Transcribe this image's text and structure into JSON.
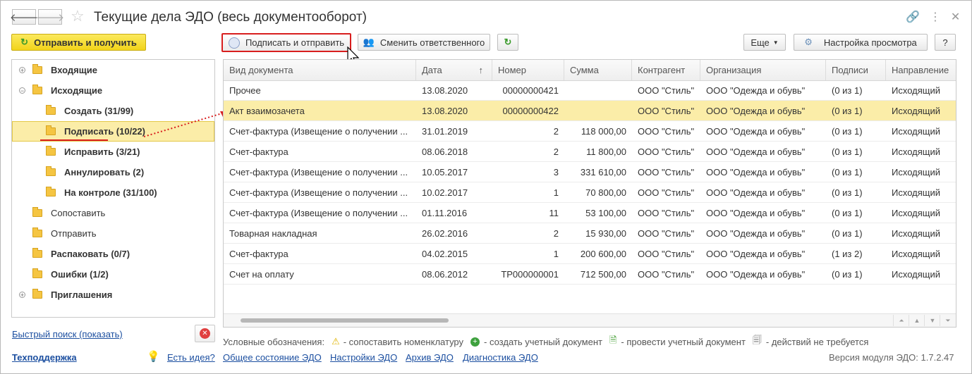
{
  "window": {
    "title": "Текущие дела ЭДО (весь документооборот)"
  },
  "toolbar": {
    "send_receive": "Отправить и получить",
    "sign_send": "Подписать и отправить",
    "change_responsible": "Сменить ответственного",
    "more": "Еще",
    "view_settings": "Настройка просмотра",
    "help": "?"
  },
  "tree": [
    {
      "label": "Входящие",
      "bold": true,
      "expander": "+"
    },
    {
      "label": "Исходящие",
      "bold": true,
      "expander": "−"
    },
    {
      "label": "Создать (31/99)",
      "bold": true
    },
    {
      "label": "Подписать (10/22)",
      "bold": true,
      "selected": true
    },
    {
      "label": "Исправить (3/21)",
      "bold": true
    },
    {
      "label": "Аннулировать (2)",
      "bold": true
    },
    {
      "label": "На контроле (31/100)",
      "bold": true
    },
    {
      "label": "Сопоставить",
      "bold": false
    },
    {
      "label": "Отправить",
      "bold": false
    },
    {
      "label": "Распаковать (0/7)",
      "bold": true
    },
    {
      "label": "Ошибки (1/2)",
      "bold": true
    },
    {
      "label": "Приглашения",
      "bold": true,
      "expander": "+"
    }
  ],
  "grid": {
    "columns": [
      "Вид документа",
      "Дата",
      "Номер",
      "Сумма",
      "Контрагент",
      "Организация",
      "Подписи",
      "Направление"
    ],
    "sort_indicator": "↑",
    "rows": [
      [
        "Прочее",
        "13.08.2020",
        "00000000421",
        "",
        "ООО \"Стиль\"",
        "ООО \"Одежда и обувь\"",
        "(0 из 1)",
        "Исходящий"
      ],
      [
        "Акт взаимозачета",
        "13.08.2020",
        "00000000422",
        "",
        "ООО \"Стиль\"",
        "ООО \"Одежда и обувь\"",
        "(0 из 1)",
        "Исходящий"
      ],
      [
        "Счет-фактура (Извещение о получении ...",
        "31.01.2019",
        "2",
        "118 000,00",
        "ООО \"Стиль\"",
        "ООО \"Одежда и обувь\"",
        "(0 из 1)",
        "Исходящий"
      ],
      [
        "Счет-фактура",
        "08.06.2018",
        "2",
        "11 800,00",
        "ООО \"Стиль\"",
        "ООО \"Одежда и обувь\"",
        "(0 из 1)",
        "Исходящий"
      ],
      [
        "Счет-фактура (Извещение о получении ...",
        "10.05.2017",
        "3",
        "331 610,00",
        "ООО \"Стиль\"",
        "ООО \"Одежда и обувь\"",
        "(0 из 1)",
        "Исходящий"
      ],
      [
        "Счет-фактура (Извещение о получении ...",
        "10.02.2017",
        "1",
        "70 800,00",
        "ООО \"Стиль\"",
        "ООО \"Одежда и обувь\"",
        "(0 из 1)",
        "Исходящий"
      ],
      [
        "Счет-фактура (Извещение о получении ...",
        "01.11.2016",
        "11",
        "53 100,00",
        "ООО \"Стиль\"",
        "ООО \"Одежда и обувь\"",
        "(0 из 1)",
        "Исходящий"
      ],
      [
        "Товарная накладная",
        "26.02.2016",
        "2",
        "15 930,00",
        "ООО \"Стиль\"",
        "ООО \"Одежда и обувь\"",
        "(0 из 1)",
        "Исходящий"
      ],
      [
        "Счет-фактура",
        "04.02.2015",
        "1",
        "200 600,00",
        "ООО \"Стиль\"",
        "ООО \"Одежда и обувь\"",
        "(1 из 2)",
        "Исходящий"
      ],
      [
        "Счет на оплату",
        "08.06.2012",
        "ТР000000001",
        "712 500,00",
        "ООО \"Стиль\"",
        "ООО \"Одежда и обувь\"",
        "(0 из 1)",
        "Исходящий"
      ]
    ],
    "selected_row": 1
  },
  "footer": {
    "quick_search": "Быстрый поиск (показать)",
    "legend_title": "Условные обозначения:",
    "legend_match": "- сопоставить номенклатуру",
    "legend_create": "- создать учетный документ",
    "legend_post": "- провести учетный документ",
    "legend_none": "- действий не требуется",
    "support": "Техподдержка",
    "idea": "Есть идея?",
    "edo_state": "Общее состояние ЭДО",
    "edo_settings": "Настройки ЭДО",
    "edo_archive": "Архив ЭДО",
    "edo_diag": "Диагностика ЭДО",
    "version": "Версия модуля ЭДО: 1.7.2.47"
  },
  "colors": {
    "accent_yellow": "#f2d41a",
    "selection": "#fbeda8",
    "link": "#1c4fa0",
    "highlight_red": "#d81e1e"
  }
}
